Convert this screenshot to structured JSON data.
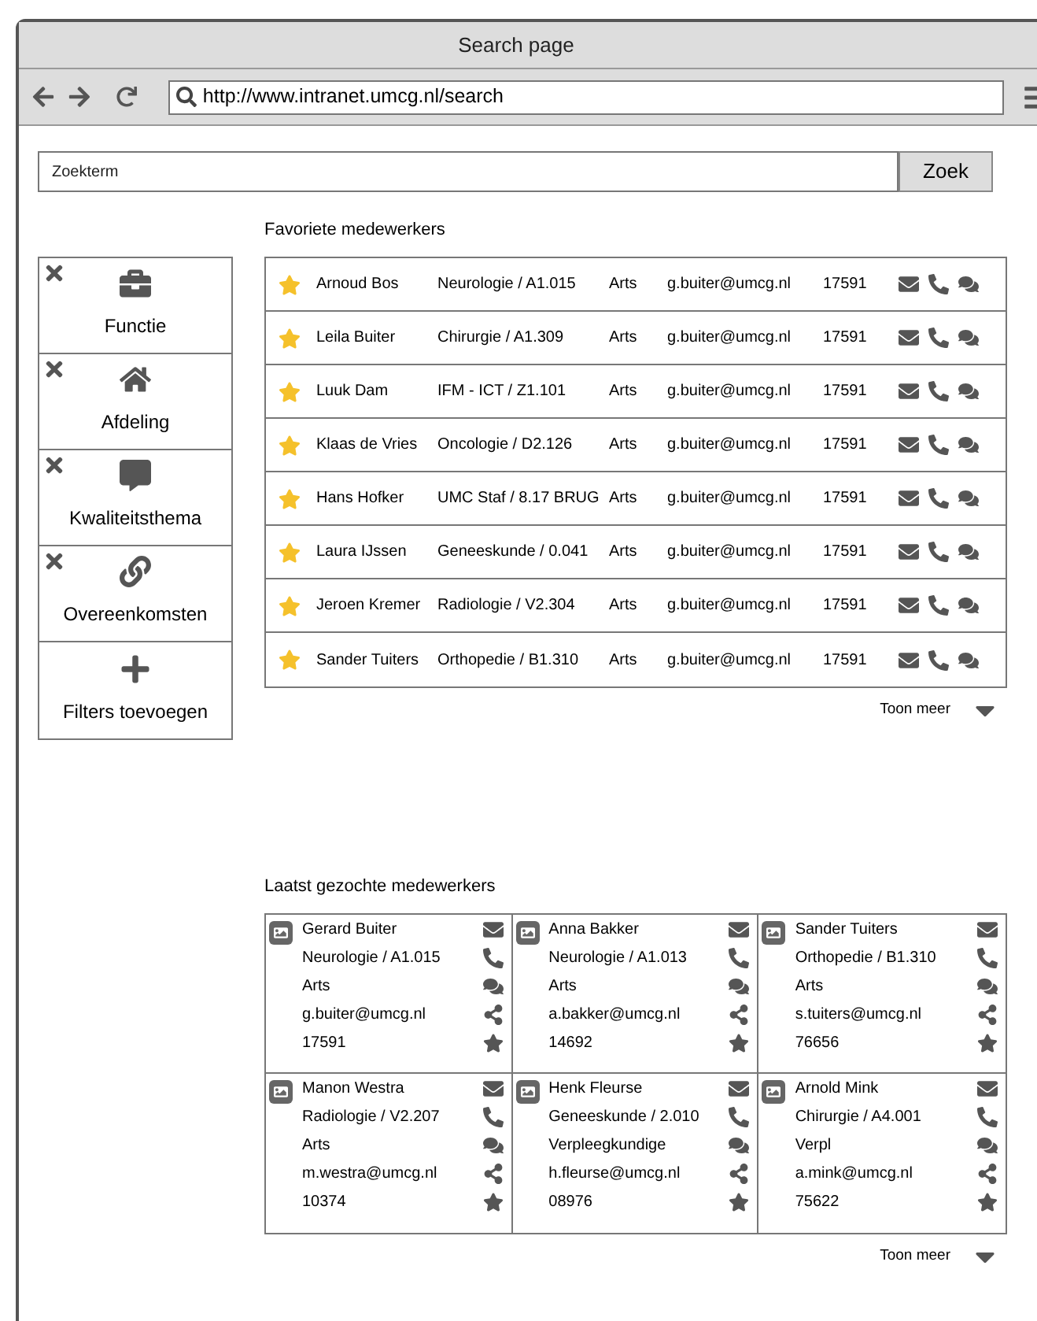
{
  "window": {
    "title": "Search page"
  },
  "browser": {
    "url": "http://www.intranet.umcg.nl/search"
  },
  "search": {
    "placeholder": "Zoekterm",
    "button": "Zoek"
  },
  "filters": [
    {
      "kind": "functie",
      "label": "Functie",
      "removable": true
    },
    {
      "kind": "afdeling",
      "label": "Afdeling",
      "removable": true
    },
    {
      "kind": "thema",
      "label": "Kwaliteitsthema",
      "removable": true
    },
    {
      "kind": "link",
      "label": "Overeenkomsten",
      "removable": true
    },
    {
      "kind": "add",
      "label": "Filters toevoegen",
      "removable": false
    }
  ],
  "favorites": {
    "title": "Favoriete medewerkers",
    "more": "Toon meer",
    "rows": [
      {
        "starred": true,
        "name": "Arnoud Bos",
        "dept": "Neurologie / A1.015",
        "role": "Arts",
        "email": "g.buiter@umcg.nl",
        "phone": "17591"
      },
      {
        "starred": true,
        "name": "Leila Buiter",
        "dept": "Chirurgie / A1.309",
        "role": "Arts",
        "email": "g.buiter@umcg.nl",
        "phone": "17591"
      },
      {
        "starred": true,
        "name": "Luuk Dam",
        "dept": "IFM - ICT / Z1.101",
        "role": "Arts",
        "email": "g.buiter@umcg.nl",
        "phone": "17591"
      },
      {
        "starred": true,
        "name": "Klaas de Vries",
        "dept": "Oncologie / D2.126",
        "role": "Arts",
        "email": "g.buiter@umcg.nl",
        "phone": "17591"
      },
      {
        "starred": true,
        "name": "Hans Hofker",
        "dept": "UMC Staf / 8.17 BRUG",
        "role": "Arts",
        "email": "g.buiter@umcg.nl",
        "phone": "17591"
      },
      {
        "starred": true,
        "name": "Laura IJssen",
        "dept": "Geneeskunde / 0.041",
        "role": "Arts",
        "email": "g.buiter@umcg.nl",
        "phone": "17591"
      },
      {
        "starred": true,
        "name": "Jeroen Kremer",
        "dept": "Radiologie / V2.304",
        "role": "Arts",
        "email": "g.buiter@umcg.nl",
        "phone": "17591"
      },
      {
        "starred": true,
        "name": "Sander Tuiters",
        "dept": "Orthopedie / B1.310",
        "role": "Arts",
        "email": "g.buiter@umcg.nl",
        "phone": "17591"
      }
    ]
  },
  "recent": {
    "title": "Laatst gezochte medewerkers",
    "more": "Toon meer",
    "cards": [
      {
        "starred": false,
        "name": "Gerard Buiter",
        "dept": "Neurologie / A1.015",
        "role": "Arts",
        "email": "g.buiter@umcg.nl",
        "phone": "17591"
      },
      {
        "starred": false,
        "name": "Anna Bakker",
        "dept": "Neurologie / A1.013",
        "role": "Arts",
        "email": "a.bakker@umcg.nl",
        "phone": "14692"
      },
      {
        "starred": false,
        "name": "Sander Tuiters",
        "dept": "Orthopedie / B1.310",
        "role": "Arts",
        "email": "s.tuiters@umcg.nl",
        "phone": "76656"
      },
      {
        "starred": false,
        "name": "Manon Westra",
        "dept": "Radiologie / V2.207",
        "role": "Arts",
        "email": "m.westra@umcg.nl",
        "phone": "10374"
      },
      {
        "starred": false,
        "name": "Henk Fleurse",
        "dept": "Geneeskunde / 2.010",
        "role": "Verpleegkundige",
        "email": "h.fleurse@umcg.nl",
        "phone": "08976"
      },
      {
        "starred": false,
        "name": "Arnold Mink",
        "dept": "Chirurgie / A4.001",
        "role": "Verpl",
        "email": "a.mink@umcg.nl",
        "phone": "75622"
      }
    ]
  }
}
